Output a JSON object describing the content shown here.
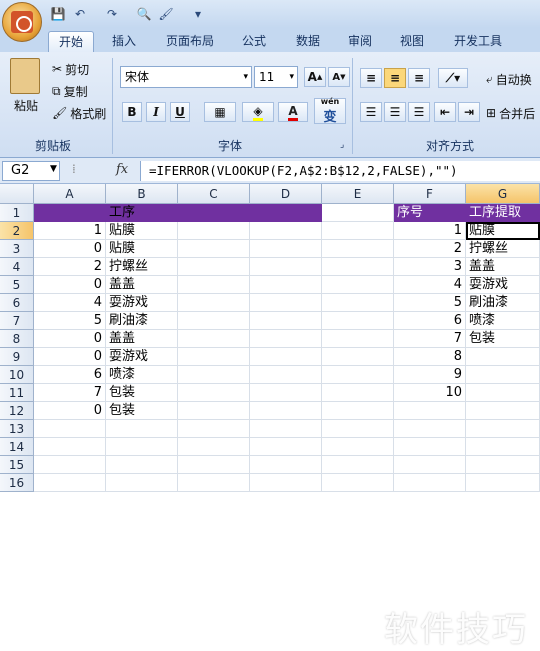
{
  "tabs": [
    "开始",
    "插入",
    "页面布局",
    "公式",
    "数据",
    "审阅",
    "视图",
    "开发工具"
  ],
  "clipboard": {
    "paste": "粘贴",
    "cut": "剪切",
    "copy": "复制",
    "format_painter": "格式刷",
    "group": "剪贴板"
  },
  "font": {
    "name": "宋体",
    "size": "11",
    "grow": "A",
    "shrink": "A",
    "bold": "B",
    "italic": "I",
    "underline": "U",
    "font_color": "A",
    "phonetic": "wén",
    "phonetic_char": "变",
    "group": "字体"
  },
  "alignment": {
    "group": "对齐方式",
    "wrap": "自动换",
    "merge": "合并后"
  },
  "formula_bar": {
    "name_box": "G2",
    "fx": "fx",
    "formula": "=IFERROR(VLOOKUP(F2,A$2:B$12,2,FALSE),\"\")"
  },
  "columns": [
    "A",
    "B",
    "C",
    "D",
    "E",
    "F",
    "G"
  ],
  "rows": [
    "1",
    "2",
    "3",
    "4",
    "5",
    "6",
    "7",
    "8",
    "9",
    "10",
    "11",
    "12",
    "13",
    "14",
    "15",
    "16"
  ],
  "sheet": {
    "header_B": "工序",
    "header_F": "序号",
    "header_G": "工序提取",
    "colA": [
      "1",
      "0",
      "2",
      "0",
      "4",
      "5",
      "0",
      "0",
      "6",
      "7",
      "0"
    ],
    "colB": [
      "贴膜",
      "贴膜",
      "拧螺丝",
      "盖盖",
      "耍游戏",
      "刷油漆",
      "盖盖",
      "耍游戏",
      "喷漆",
      "包装",
      "包装"
    ],
    "colF": [
      "1",
      "2",
      "3",
      "4",
      "5",
      "6",
      "7",
      "8",
      "9",
      "10"
    ],
    "colG": [
      "贴膜",
      "拧螺丝",
      "盖盖",
      "耍游戏",
      "刷油漆",
      "喷漆",
      "包装",
      "",
      "",
      ""
    ]
  },
  "watermark": "软件技巧",
  "colors": {
    "header_fill": "#7030a0",
    "ribbon": "#dbe7f6"
  }
}
